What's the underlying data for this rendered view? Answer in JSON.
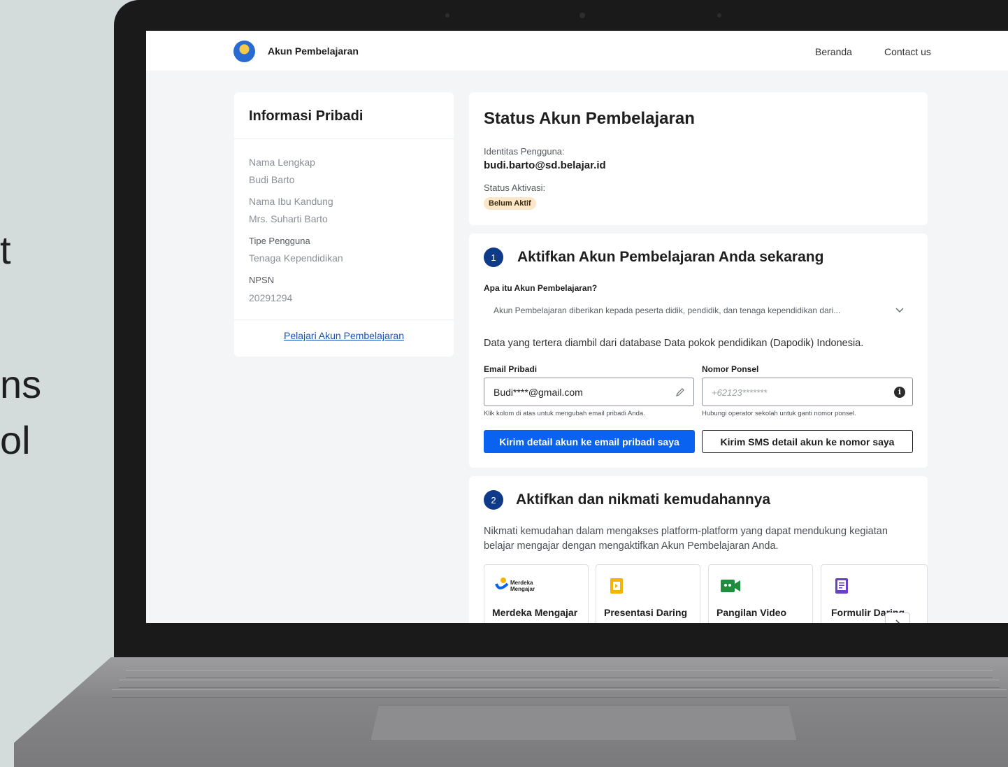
{
  "background_text": [
    "t",
    "ns",
    "ol"
  ],
  "header": {
    "brand": "Akun Pembelajaran",
    "nav": [
      "Beranda",
      "Contact us"
    ]
  },
  "personal_info": {
    "title": "Informasi Pribadi",
    "fields": [
      {
        "label": "Nama Lengkap",
        "value": "Budi Barto"
      },
      {
        "label": "Nama Ibu Kandung",
        "value": "Mrs. Suharti Barto"
      },
      {
        "label": "Tipe Pengguna",
        "value": "Tenaga Kependidikan"
      },
      {
        "label": "NPSN",
        "value": "20291294"
      }
    ],
    "link": "Pelajari Akun Pembelajaran"
  },
  "status": {
    "title": "Status Akun Pembelajaran",
    "identity_label": "Identitas Pengguna:",
    "identity_value": "budi.barto@sd.belajar.id",
    "activation_label": "Status Aktivasi:",
    "activation_badge": "Belum Aktif"
  },
  "step1": {
    "number": "1",
    "title": "Aktifkan Akun Pembelajaran Anda sekarang",
    "faq_question": "Apa itu Akun Pembelajaran?",
    "faq_answer": "Akun Pembelajaran diberikan kepada peserta didik, pendidik, dan tenaga kependidikan dari...",
    "source_note": "Data yang tertera diambil dari database Data pokok pendidikan (Dapodik) Indonesia.",
    "email_label": "Email Pribadi",
    "email_value": "Budi****@gmail.com",
    "email_help": "Klik kolom di atas untuk mengubah email pribadi Anda.",
    "phone_label": "Nomor Ponsel",
    "phone_placeholder": "+62123*******",
    "phone_help": "Hubungi operator sekolah untuk ganti nomor ponsel.",
    "primary_button": "Kirim detail akun ke email pribadi saya",
    "secondary_button": "Kirim SMS detail akun ke nomor saya"
  },
  "step2": {
    "number": "2",
    "title": "Aktifkan dan nikmati kemudahannya",
    "description": "Nikmati kemudahan dalam mengakses platform-platform yang dapat mendukung kegiatan belajar mengajar dengan mengaktifkan Akun Pembelajaran Anda.",
    "apps": [
      {
        "name": "Merdeka Mengajar",
        "icon": "merdeka-mengajar-logo",
        "logo_text": "Merdeka Mengajar"
      },
      {
        "name": "Presentasi Daring",
        "icon": "slides-icon"
      },
      {
        "name": "Pangilan Video",
        "icon": "video-call-icon"
      },
      {
        "name": "Formulir Daring",
        "icon": "forms-icon"
      }
    ]
  },
  "colors": {
    "primary": "#0a62f0",
    "step_badge": "#0f3a89",
    "status_badge_bg": "#fbe6c8",
    "page_bg": "#f4f5f7"
  }
}
